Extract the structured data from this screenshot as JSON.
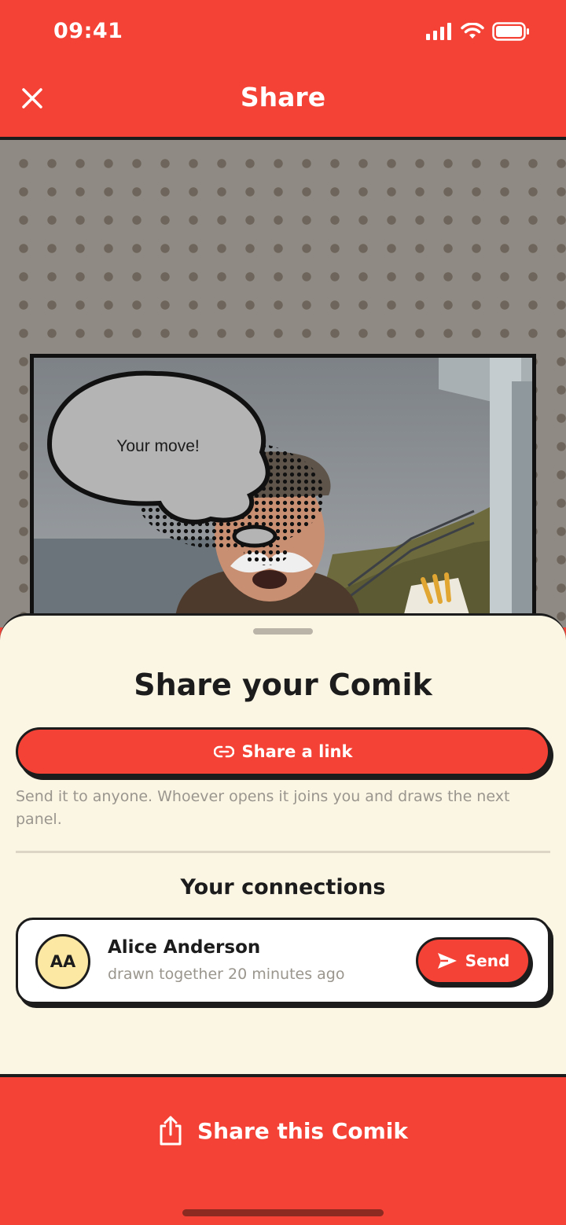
{
  "status_bar": {
    "time": "09:41"
  },
  "header": {
    "title": "Share"
  },
  "preview": {
    "speech_text": "Your move!"
  },
  "sheet": {
    "title": "Share your Comik",
    "share_link_label": "Share a link",
    "helper_text": "Send it to anyone. Whoever opens it joins you and draws the next panel.",
    "connections_title": "Your connections",
    "connections": [
      {
        "initials": "AA",
        "name": "Alice Anderson",
        "subtitle": "drawn together 20 minutes ago",
        "send_label": "Send"
      }
    ]
  },
  "bottom_bar": {
    "label": "Share this Comik"
  },
  "colors": {
    "accent": "#f44336",
    "sheet_bg": "#fbf5e4",
    "ink": "#1c1c1c",
    "avatar_bg": "#fce7a3"
  }
}
